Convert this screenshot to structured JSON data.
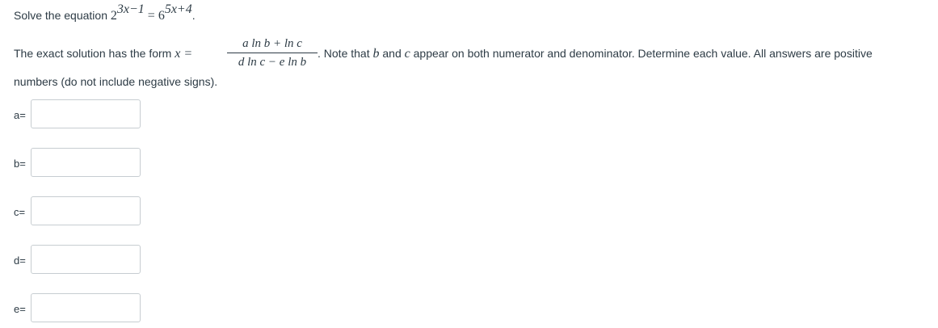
{
  "question": {
    "line1_prefix": "Solve the equation ",
    "eq_base_left": "2",
    "eq_exp_left": "3x−1",
    "eq_equals": " = ",
    "eq_base_right": "6",
    "eq_exp_right": "5x+4",
    "eq_end": ".",
    "line2_prefix": "The exact solution has the form ",
    "form_lhs": "x =",
    "fraction_numerator": "a ln b + ln c",
    "fraction_denominator": "d ln c − e ln b",
    "line2_suffix_pre": ". Note that ",
    "var_b": "b",
    "line2_and": " and ",
    "var_c": "c",
    "line2_suffix_post": " appear on both numerator and denominator. Determine each value. All answers are positive",
    "line3": "numbers (do not include negative signs)."
  },
  "answers": [
    {
      "label": "a=",
      "value": ""
    },
    {
      "label": "b=",
      "value": ""
    },
    {
      "label": "c=",
      "value": ""
    },
    {
      "label": "d=",
      "value": ""
    },
    {
      "label": "e=",
      "value": ""
    }
  ]
}
